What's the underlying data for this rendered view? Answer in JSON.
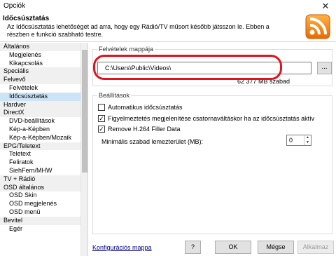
{
  "window": {
    "title": "Opciók",
    "close_symbol": "✕"
  },
  "header": {
    "title": "Időcsúsztatás",
    "description": "Az Időcsúsztatás lehetőséget ad arra, hogy egy Rádió/TV műsort később játsszon le. Ebben a részben e funkció szabható testre.",
    "logo_icon": "rss-feed-icon",
    "accent": "#f07800"
  },
  "tree": {
    "items": [
      {
        "label": "Általános",
        "level": 0
      },
      {
        "label": "Megjelenés",
        "level": 1
      },
      {
        "label": "Kikapcsolás",
        "level": 1
      },
      {
        "label": "Speciális",
        "level": 0
      },
      {
        "label": "Felvevő",
        "level": 0
      },
      {
        "label": "Felvételek",
        "level": 1
      },
      {
        "label": "Időcsúsztatás",
        "level": 1,
        "selected": true
      },
      {
        "label": "Hardver",
        "level": 0
      },
      {
        "label": "DirectX",
        "level": 0
      },
      {
        "label": "DVD-beállítások",
        "level": 1
      },
      {
        "label": "Kép-a-Képben",
        "level": 1
      },
      {
        "label": "Kép-a-Képben/Mozaik",
        "level": 1
      },
      {
        "label": "EPG/Teletext",
        "level": 0
      },
      {
        "label": "Teletext",
        "level": 1
      },
      {
        "label": "Feliratok",
        "level": 1
      },
      {
        "label": "SiehFern/MHW",
        "level": 1
      },
      {
        "label": "TV + Rádió",
        "level": 0
      },
      {
        "label": "OSD általános",
        "level": 0
      },
      {
        "label": "OSD Skin",
        "level": 1
      },
      {
        "label": "OSD megjelenés",
        "level": 1
      },
      {
        "label": "OSD menü",
        "level": 1
      },
      {
        "label": "Bevitel",
        "level": 0
      },
      {
        "label": "Egér",
        "level": 1
      }
    ]
  },
  "folder_group": {
    "title": "Felvételek mappája",
    "path_value": "C:\\Users\\Public\\Videos\\",
    "browse_label": "...",
    "free_space": "62 377 MB szabad",
    "highlight_color": "#e0141e"
  },
  "settings_group": {
    "title": "Beállítások",
    "checkboxes": [
      {
        "label": "Automatikus időcsúsztatás",
        "checked": false
      },
      {
        "label": "Figyelmeztetés megjelenítése csatornaváltáskor ha az időcsúsztatás aktív",
        "checked": true
      },
      {
        "label": "Remove H.264 Filler Data",
        "checked": true
      }
    ],
    "min_free_label": "Minimális szabad lemezterület (MB):",
    "min_free_value": "0"
  },
  "footer": {
    "config_link": "Konfigurációs mappa",
    "help_label": "?",
    "ok_label": "OK",
    "cancel_label": "Mégse",
    "apply_label": "Alkalmaz"
  }
}
